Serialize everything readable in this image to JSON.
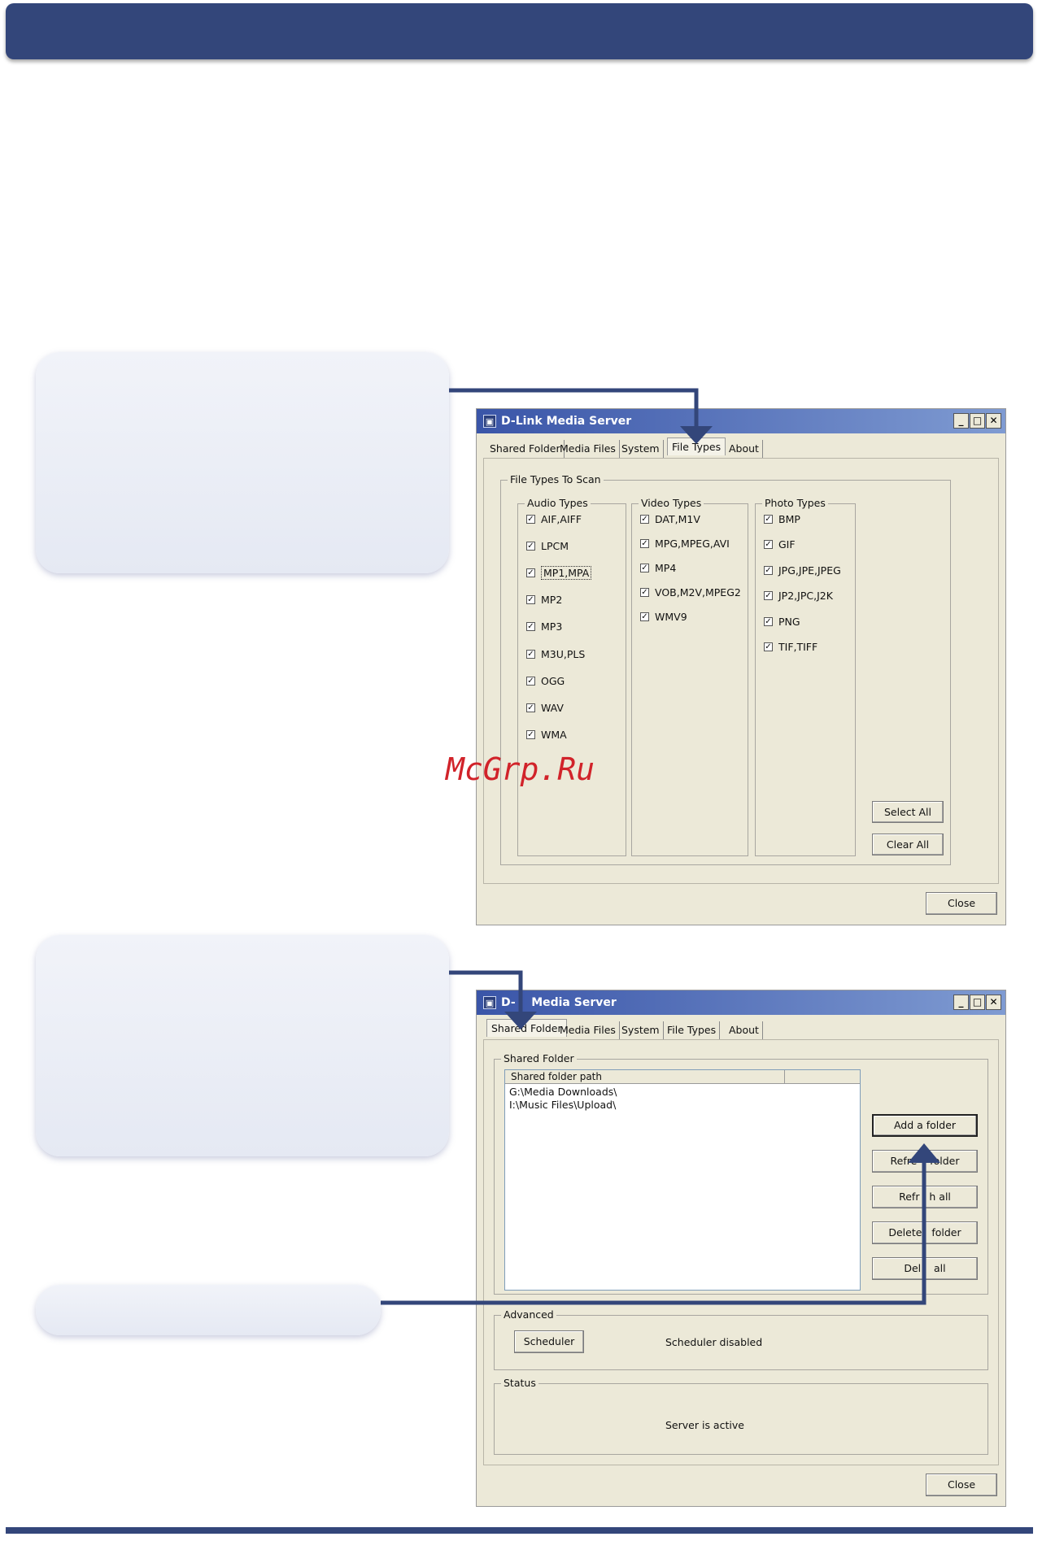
{
  "colors": {
    "brand_navy": "#33467a",
    "callout_bg": "#e9ecf5",
    "window_bg": "#ece9d8",
    "titlebar": "#3a55a8",
    "watermark": "#d1232a"
  },
  "watermark": "McGrp.Ru",
  "window1": {
    "title": "D-Link Media Server",
    "tabs": [
      "Shared Folder",
      "Media Files",
      "System",
      "File Types",
      "About"
    ],
    "active_tab": "File Types",
    "group_title": "File Types To Scan",
    "audio": {
      "title": "Audio Types",
      "items": [
        "AIF,AIFF",
        "LPCM",
        "MP1,MPA",
        "MP2",
        "MP3",
        "M3U,PLS",
        "OGG",
        "WAV",
        "WMA"
      ]
    },
    "video": {
      "title": "Video Types",
      "items": [
        "DAT,M1V",
        "MPG,MPEG,AVI",
        "MP4",
        "VOB,M2V,MPEG2",
        "WMV9"
      ]
    },
    "photo": {
      "title": "Photo Types",
      "items": [
        "BMP",
        "GIF",
        "JPG,JPE,JPEG",
        "JP2,JPC,J2K",
        "PNG",
        "TIF,TIFF"
      ]
    },
    "checked": "✓",
    "select_all": "Select All",
    "clear_all": "Clear All",
    "close": "Close"
  },
  "window2": {
    "title_visible": "D-    Media Server",
    "tabs": [
      "Shared Folder",
      "Media Files",
      "System",
      "File Types",
      "About"
    ],
    "active_tab": "Shared Folder",
    "shared_group": "Shared Folder",
    "column_header": "Shared folder path",
    "paths": [
      "G:\\Media Downloads\\",
      "I:\\Music Files\\Upload\\"
    ],
    "buttons": [
      "Add a folder",
      "Refre    folder",
      "Refr   h all",
      "Delete   folder",
      "Del    all"
    ],
    "advanced_group": "Advanced",
    "scheduler_button": "Scheduler",
    "scheduler_status": "Scheduler disabled",
    "status_group": "Status",
    "server_status": "Server is active",
    "close": "Close"
  }
}
